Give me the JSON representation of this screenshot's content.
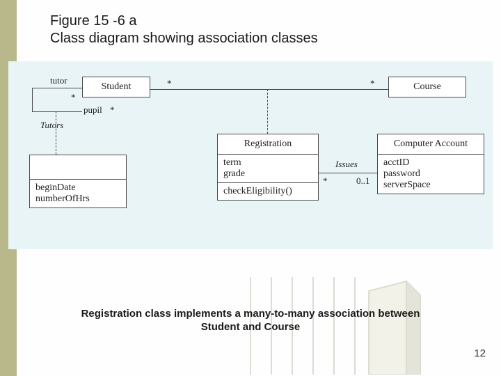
{
  "title": {
    "line1": "Figure 15 -6 a",
    "line2": "Class diagram showing association classes"
  },
  "classes": {
    "student": {
      "name": "Student"
    },
    "course": {
      "name": "Course"
    },
    "registration": {
      "name": "Registration",
      "attrs": "term\ngrade",
      "ops": "checkEligibility()"
    },
    "computerAccount": {
      "name": "Computer Account",
      "attrs": "acctID\npassword\nserverSpace"
    },
    "tutorAssoc": {
      "attrs": "beginDate\nnumberOfHrs"
    }
  },
  "labels": {
    "tutor": "tutor",
    "pupil": "pupil",
    "tutors": "Tutors",
    "issues": "Issues",
    "star1": "*",
    "star2": "*",
    "star3": "*",
    "star4": "*",
    "star5": "*",
    "zeroOne": "0..1"
  },
  "caption": {
    "l1": "Registration class implements a many-to-many association between",
    "l2": "Student and Course"
  },
  "pageNumber": "12"
}
